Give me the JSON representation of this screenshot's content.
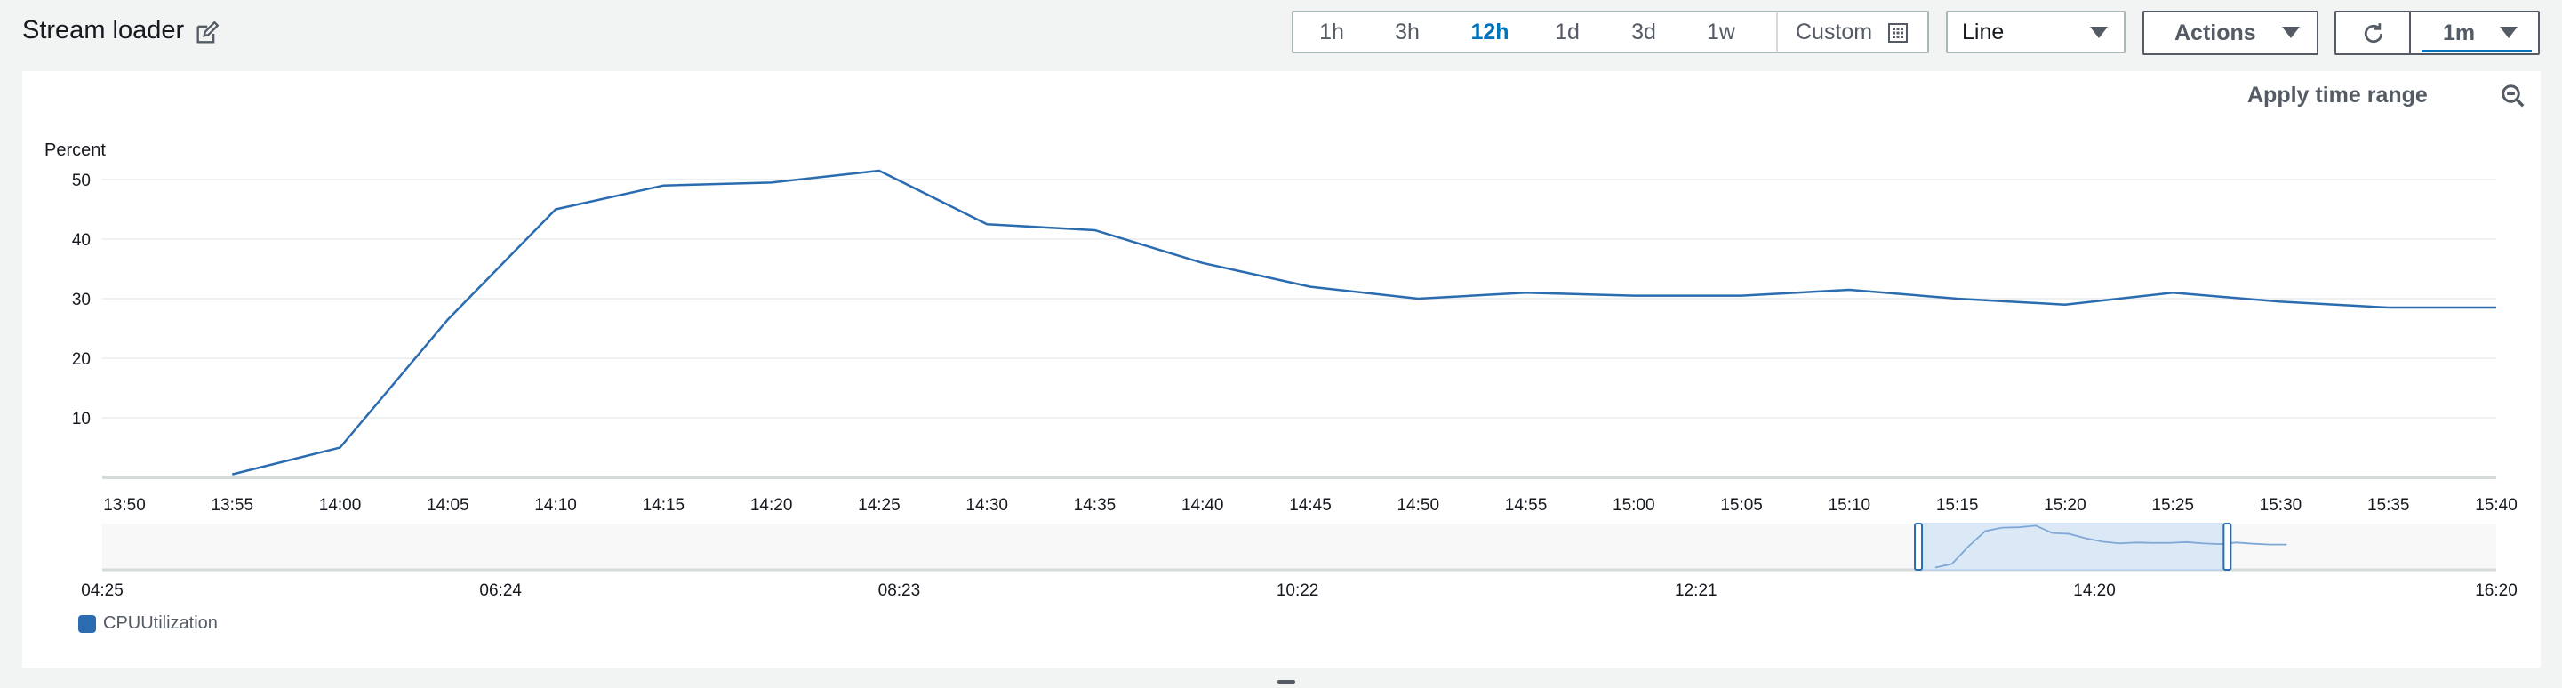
{
  "header": {
    "title": "Stream loader"
  },
  "time_ranges": [
    {
      "label": "1h",
      "active": false
    },
    {
      "label": "3h",
      "active": false
    },
    {
      "label": "12h",
      "active": true
    },
    {
      "label": "1d",
      "active": false
    },
    {
      "label": "3d",
      "active": false
    },
    {
      "label": "1w",
      "active": false
    }
  ],
  "custom_label": "Custom",
  "graph_type": {
    "selected": "Line"
  },
  "actions_label": "Actions",
  "period": {
    "selected": "1m"
  },
  "apply_time_range": "Apply time range",
  "colors": {
    "series": "#2b6cb0",
    "accent": "#0073bb",
    "brush_fill": "#dbe9f7"
  },
  "icons": [
    "edit-icon",
    "calendar-icon",
    "caret-down-icon",
    "refresh-icon",
    "zoom-out-icon"
  ],
  "chart_data": {
    "type": "line",
    "ylabel": "Percent",
    "ylim": [
      0,
      50
    ],
    "yticks": [
      10,
      20,
      30,
      40,
      50
    ],
    "x_ticks": [
      "13:50",
      "13:55",
      "14:00",
      "14:05",
      "14:10",
      "14:15",
      "14:20",
      "14:25",
      "14:30",
      "14:35",
      "14:40",
      "14:45",
      "14:50",
      "14:55",
      "15:00",
      "15:05",
      "15:10",
      "15:15",
      "15:20",
      "15:25",
      "15:30",
      "15:35",
      "15:40"
    ],
    "grid": true,
    "legend_position": "bottom-left",
    "series": [
      {
        "name": "CPUUtilization",
        "x": [
          "13:55",
          "14:00",
          "14:05",
          "14:10",
          "14:15",
          "14:20",
          "14:25",
          "14:30",
          "14:35",
          "14:40",
          "14:45",
          "14:50",
          "14:55",
          "15:00",
          "15:05",
          "15:10",
          "15:15",
          "15:20",
          "15:25",
          "15:30",
          "15:35",
          "15:40"
        ],
        "values": [
          0.5,
          5,
          26.5,
          45,
          49,
          49.5,
          51.5,
          42.5,
          41.5,
          36,
          32,
          30,
          31,
          30.5,
          30.5,
          31.5,
          30,
          29,
          31,
          29.5,
          28.5,
          28.5
        ]
      }
    ],
    "overview": {
      "x_ticks": [
        "04:25",
        "06:24",
        "08:23",
        "10:22",
        "12:21",
        "14:20",
        "16:20"
      ],
      "selected_range": [
        "13:50",
        "15:40"
      ]
    }
  }
}
